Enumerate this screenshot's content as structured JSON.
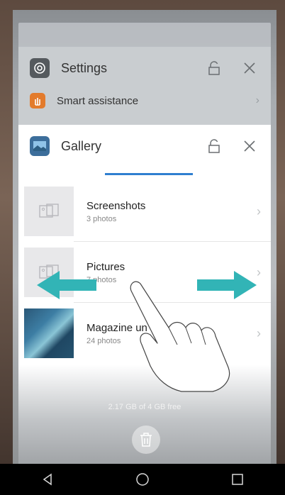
{
  "recents": {
    "settings_card": {
      "title": "Settings",
      "row_label": "Smart assistance"
    },
    "gallery_card": {
      "title": "Gallery",
      "albums": [
        {
          "name": "Screenshots",
          "count": "3 photos"
        },
        {
          "name": "Pictures",
          "count": "7 photos"
        },
        {
          "name": "Magazine un",
          "count": "24 photos"
        }
      ]
    },
    "storage_text": "2.17 GB of 4 GB free"
  },
  "colors": {
    "accent": "#2f7fd0",
    "gesture_arrow": "#32b4b6"
  },
  "icons": [
    "settings-icon",
    "lock-icon",
    "close-icon",
    "smart-assistance-icon",
    "gallery-icon",
    "chevron-right-icon",
    "image-placeholder-icon",
    "trash-icon",
    "back-icon",
    "home-icon",
    "recents-icon",
    "swipe-hand-icon"
  ]
}
